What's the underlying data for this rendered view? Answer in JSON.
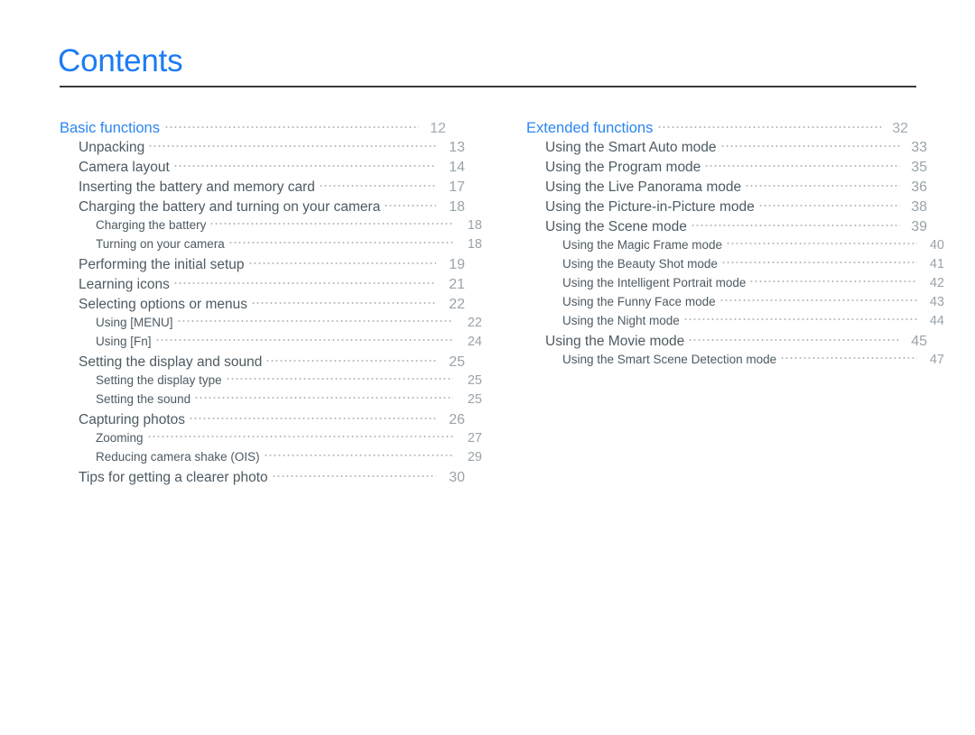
{
  "document": {
    "title": "Contents",
    "accent_color": "#2b86f0",
    "title_color": "#1c7bf5",
    "text_color": "#4d5a63",
    "page_number_color": "#9aa3a9",
    "leader_color": "#b4b9bd",
    "background_color": "#ffffff",
    "rule_color": "#3a3a3a"
  },
  "columns": [
    {
      "id": "left-column",
      "entries": [
        {
          "level": 1,
          "label": "Basic functions",
          "page": "12"
        },
        {
          "level": 2,
          "label": "Unpacking",
          "page": "13"
        },
        {
          "level": 2,
          "label": "Camera layout",
          "page": "14"
        },
        {
          "level": 2,
          "label": "Inserting the battery and memory card",
          "page": "17"
        },
        {
          "level": 2,
          "label": "Charging the battery and turning on your camera",
          "page": "18"
        },
        {
          "level": 3,
          "label": "Charging the battery",
          "page": "18"
        },
        {
          "level": 3,
          "label": "Turning on your camera",
          "page": "18"
        },
        {
          "level": 2,
          "label": "Performing the initial setup",
          "page": "19"
        },
        {
          "level": 2,
          "label": "Learning icons",
          "page": "21"
        },
        {
          "level": 2,
          "label": "Selecting options or menus",
          "page": "22"
        },
        {
          "level": 3,
          "label": "Using [MENU]",
          "page": "22"
        },
        {
          "level": 3,
          "label": "Using [Fn]",
          "page": "24"
        },
        {
          "level": 2,
          "label": "Setting the display and sound",
          "page": "25"
        },
        {
          "level": 3,
          "label": "Setting the display type",
          "page": "25"
        },
        {
          "level": 3,
          "label": "Setting the sound",
          "page": "25"
        },
        {
          "level": 2,
          "label": "Capturing photos",
          "page": "26"
        },
        {
          "level": 3,
          "label": "Zooming",
          "page": "27"
        },
        {
          "level": 3,
          "label": "Reducing camera shake (OIS)",
          "page": "29"
        },
        {
          "level": 2,
          "label": "Tips for getting a clearer photo",
          "page": "30"
        }
      ]
    },
    {
      "id": "right-column",
      "entries": [
        {
          "level": 1,
          "label": "Extended functions",
          "page": "32"
        },
        {
          "level": 2,
          "label": "Using the Smart Auto mode",
          "page": "33"
        },
        {
          "level": 2,
          "label": "Using the Program mode",
          "page": "35"
        },
        {
          "level": 2,
          "label": "Using the Live Panorama mode",
          "page": "36"
        },
        {
          "level": 2,
          "label": "Using the Picture-in-Picture mode",
          "page": "38"
        },
        {
          "level": 2,
          "label": "Using the Scene mode",
          "page": "39"
        },
        {
          "level": 3,
          "label": "Using the Magic Frame mode",
          "page": "40"
        },
        {
          "level": 3,
          "label": "Using the Beauty Shot mode",
          "page": "41"
        },
        {
          "level": 3,
          "label": "Using the Intelligent Portrait mode",
          "page": "42"
        },
        {
          "level": 3,
          "label": "Using the Funny Face mode",
          "page": "43"
        },
        {
          "level": 3,
          "label": "Using the Night mode",
          "page": "44"
        },
        {
          "level": 2,
          "label": "Using the Movie mode",
          "page": "45"
        },
        {
          "level": 3,
          "label": "Using the Smart Scene Detection mode",
          "page": "47"
        }
      ]
    }
  ]
}
